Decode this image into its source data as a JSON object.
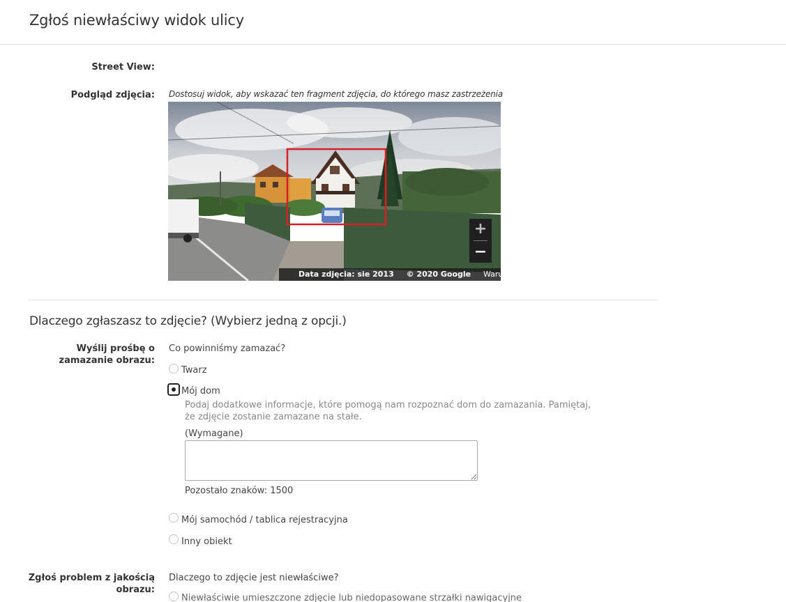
{
  "page": {
    "title": "Zgłoś niewłaściwy widok ulicy"
  },
  "street_view": {
    "label": "Street View:"
  },
  "preview": {
    "label": "Podgląd zdjęcia:",
    "hint": "Dostosuj widok, aby wskazać ten fragment zdjęcia, do którego masz zastrzeżenia",
    "zoom_in": "+",
    "zoom_out": "−",
    "photo_date": "Data zdjęcia: sie 2013",
    "copyright": "© 2020 Google",
    "terms": "Warunki",
    "selection_color": "#d81f26"
  },
  "reason": {
    "title": "Dlaczego zgłaszasz to zdjęcie? (Wybierz jedną z opcji.)",
    "blur": {
      "label_line1": "Wyślij prośbę o",
      "label_line2": "zamazanie obrazu:",
      "question": "Co powinniśmy zamazać?",
      "options": [
        {
          "label": "Twarz",
          "selected": false
        },
        {
          "label": "Mój dom",
          "selected": true
        },
        {
          "label": "Mój samochód / tablica rejestracyjna",
          "selected": false
        },
        {
          "label": "Inny obiekt",
          "selected": false
        }
      ],
      "house_description_line1": "Podaj dodatkowe informacje, które pomogą nam rozpoznać dom do zamazania. Pamiętaj,",
      "house_description_line2": "że zdjęcie zostanie zamazane na stałe.",
      "required": "(Wymagane)",
      "details_value": "",
      "remaining_label": "Pozostało znaków: 1500"
    },
    "quality": {
      "label_line1": "Zgłoś problem z jakością",
      "label_line2": "obrazu:",
      "question": "Dlaczego to zdjęcie jest niewłaściwe?",
      "options": [
        {
          "label": "Niewłaściwie umieszczone zdjęcie lub niedopasowane strzałki nawigacyjne",
          "selected": false
        }
      ]
    }
  }
}
